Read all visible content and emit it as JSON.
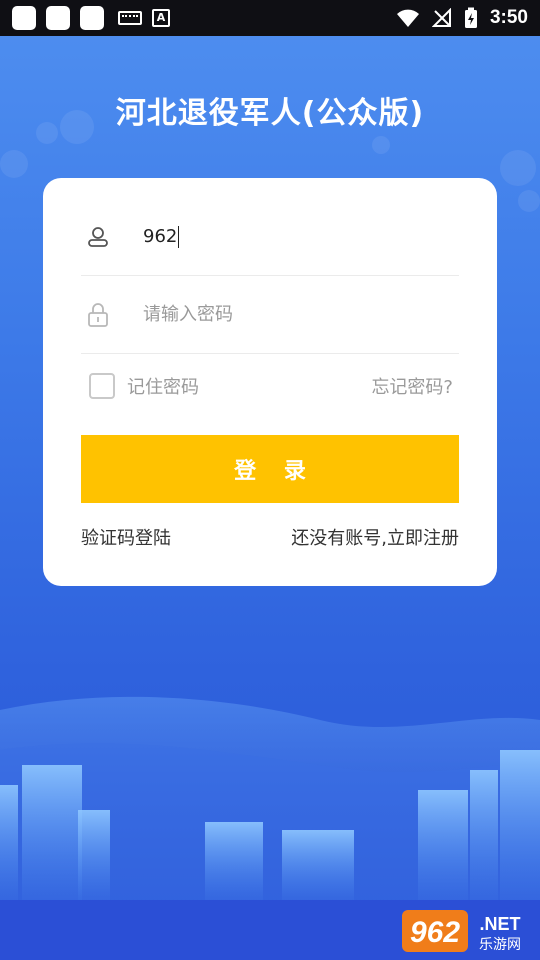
{
  "status_bar": {
    "time": "3:50"
  },
  "app": {
    "title": "河北退役军人(公众版)"
  },
  "login": {
    "username_value": "962",
    "password_placeholder": "请输入密码",
    "remember_label": "记住密码",
    "remember_checked": false,
    "forgot_label": "忘记密码?",
    "login_button": "登 录",
    "sms_login_link": "验证码登陆",
    "register_link": "还没有账号,立即注册"
  },
  "colors": {
    "accent": "#ffc200",
    "background_top": "#4f8ff0",
    "background_bottom": "#2a55d6"
  },
  "watermark": {
    "number": "962",
    "suffix": ".NET",
    "subtitle": "乐游网"
  }
}
